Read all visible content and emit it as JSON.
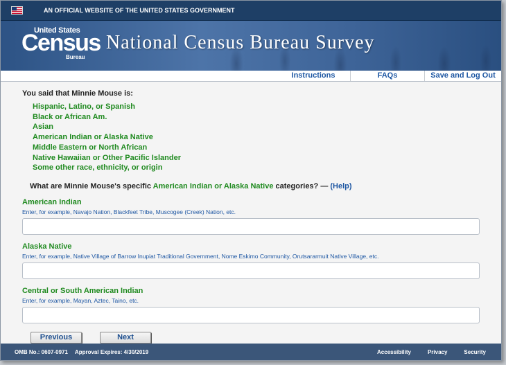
{
  "gov_bar": {
    "text": "AN OFFICIAL WEBSITE OF THE UNITED STATES GOVERNMENT"
  },
  "header": {
    "logo_top": "United States",
    "logo_word": "Census",
    "logo_bottom": "Bureau",
    "title": "National Census Bureau Survey"
  },
  "nav": {
    "instructions": "Instructions",
    "faqs": "FAQs",
    "logout": "Save and Log Out"
  },
  "summary": {
    "intro": "You said that Minnie Mouse is:",
    "races": [
      "Hispanic, Latino, or Spanish",
      "Black or African Am.",
      "Asian",
      "American Indian or Alaska Native",
      "Middle Eastern or North African",
      "Native Hawaiian or Other Pacific Islander",
      "Some other race, ethnicity, or origin"
    ]
  },
  "question": {
    "prefix": "What are Minnie Mouse's specific ",
    "highlight": "American Indian or Alaska Native",
    "suffix": " categories? — ",
    "help": "(Help)"
  },
  "fields": [
    {
      "label": "American Indian",
      "hint": "Enter, for example, Navajo Nation, Blackfeet Tribe, Muscogee (Creek) Nation, etc.",
      "value": ""
    },
    {
      "label": "Alaska Native",
      "hint": "Enter, for example, Native Village of Barrow Inupiat Traditional Government, Nome Eskimo Community, Orutsararmuit Native Village, etc.",
      "value": ""
    },
    {
      "label": "Central or South American Indian",
      "hint": "Enter, for example, Mayan, Aztec, Taino, etc.",
      "value": ""
    }
  ],
  "buttons": {
    "previous": "Previous",
    "next": "Next"
  },
  "footer": {
    "omb": "OMB No.: 0607-0971",
    "approval": "Approval Expires: 4/30/2019",
    "accessibility": "Accessibility",
    "privacy": "Privacy",
    "security": "Security"
  },
  "colors": {
    "header_bar": "#1e3f66",
    "accent_green": "#1f8a1f",
    "link_blue": "#1e57a3",
    "footer": "#3b5679"
  }
}
